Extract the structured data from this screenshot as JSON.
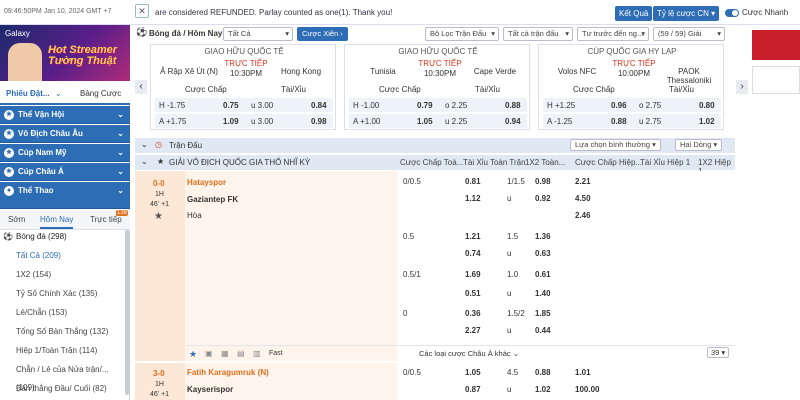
{
  "top": {
    "clock": "09:46:50PM Jan 10, 2024 GMT +7",
    "marquee": "are considered REFUNDED. Parlay counted as one(1). Thank you!",
    "result_btn": "Kết Quả",
    "odds_btn": "Tỷ lệ cược CN",
    "fast_label": "Cược Nhanh"
  },
  "sidebar": {
    "banner_logo": "Galaxy",
    "banner_line1": "Hot Streamer",
    "banner_line2": "Tường Thuật",
    "tab1": "Phiếu Đặt...",
    "tab2": "Bảng Cược",
    "cats": [
      "Thể Vận Hội",
      "Vô Địch Châu Âu",
      "Cúp Nam Mỹ",
      "Cúp Châu Á",
      "Thể Thao"
    ],
    "sub": [
      "Sớm",
      "Hôm Nay",
      "Trực tiếp"
    ],
    "badge": "136",
    "sports": [
      "Bóng đá (298)",
      "Tất Cả (209)",
      "1X2 (154)",
      "Tỷ Số Chính Xác (135)",
      "Lẻ/Chẵn (153)",
      "Tổng Số Bàn Thắng (132)",
      "Hiệp 1/Toàn Trận (114)",
      "Chẵn / Lẻ của Nửa trận/... (109)",
      "Bàn thắng Đầu/ Cuối (82)"
    ]
  },
  "feat": {
    "title": "Bóng đá / Hôm Nay",
    "sel1": "Tất Cả",
    "btn": "Cược Xiên",
    "f1": "Bộ Lọc Trận Đấu",
    "f2": "Tất cả trận đấu",
    "f3": "Tư trước đến ng...",
    "count": "(59 / 59) Giải"
  },
  "cards": [
    {
      "league": "GIAO HỮU QUỐC TẾ",
      "home": "Ả Rập Xê Út (N)",
      "away": "Hong Kong",
      "live": "TRỰC TIẾP",
      "time": "10:30PM",
      "hcap": "Cược Chấp",
      "ou": "Tài/Xỉu",
      "r1": [
        "H -1.75",
        "0.75",
        "u 3.00",
        "0.84"
      ],
      "r2": [
        "A +1.75",
        "1.09",
        "u 3.00",
        "0.98"
      ]
    },
    {
      "league": "GIAO HỮU QUỐC TẾ",
      "home": "Tunisia",
      "away": "Cape Verde",
      "live": "TRỰC TIẾP",
      "time": "10:30PM",
      "hcap": "Cược Chấp",
      "ou": "Tài/Xỉu",
      "r1": [
        "H -1.00",
        "0.79",
        "o 2.25",
        "0.88"
      ],
      "r2": [
        "A +1.00",
        "1.05",
        "u 2.25",
        "0.94"
      ]
    },
    {
      "league": "CÚP QUỐC GIA HY LẠP",
      "home": "Volos NFC",
      "away": "PAOK Thessaloniki",
      "live": "TRỰC TIẾP",
      "time": "10:00PM",
      "hcap": "Cược Chấp",
      "ou": "Tài/Xỉu",
      "r1": [
        "H +1.25",
        "0.96",
        "o 2.75",
        "0.80"
      ],
      "r2": [
        "A -1.25",
        "0.88",
        "u 2.75",
        "1.02"
      ]
    }
  ],
  "main": {
    "tdlabel": "Trận Đấu",
    "sort": "Lựa chọn bình thường",
    "mode": "Hai Dòng",
    "league": "GIẢI VÔ ĐỊCH QUỐC GIA THỔ NHĨ KỲ",
    "cols": [
      "Cược Chấp Toà...",
      "Tài Xỉu Toàn Trận",
      "1X2 Toàn...",
      "Cược Chấp Hiệp...",
      "Tài Xỉu Hiệp 1",
      "1X2 Hiệp 1"
    ],
    "more": "Các loại cược Châu Á khác",
    "page": "39",
    "fast": "Fast"
  },
  "ev1": {
    "score": "0-0",
    "half": "1H",
    "min": "46' +1",
    "home": "Hatayspor",
    "away": "Gaziantep FK",
    "draw": "Hòa",
    "rows": [
      [
        "0/0.5",
        "0.81",
        "1/1.5",
        "0.98",
        "2.21"
      ],
      [
        "",
        "1.12",
        "u",
        "0.92",
        "4.50"
      ],
      [
        "",
        "",
        "",
        "",
        "2.46"
      ],
      [
        "0.5",
        "1.21",
        "1.5",
        "1.36",
        ""
      ],
      [
        "",
        "0.74",
        "u",
        "0.63",
        ""
      ],
      [
        "0.5/1",
        "1.69",
        "1.0",
        "0.61",
        ""
      ],
      [
        "",
        "0.51",
        "u",
        "1.40",
        ""
      ],
      [
        "0",
        "0.36",
        "1.5/2",
        "1.85",
        ""
      ],
      [
        "",
        "2.27",
        "u",
        "0.44",
        ""
      ]
    ]
  },
  "ev2": {
    "score": "3-0",
    "half": "1H",
    "min": "46' +1",
    "home": "Fatih Karagumruk (N)",
    "away": "Kayserispor",
    "rows": [
      [
        "0/0.5",
        "1.05",
        "4.5",
        "0.88",
        "1.01"
      ],
      [
        "",
        "0.87",
        "u",
        "1.02",
        "100.00"
      ]
    ]
  }
}
